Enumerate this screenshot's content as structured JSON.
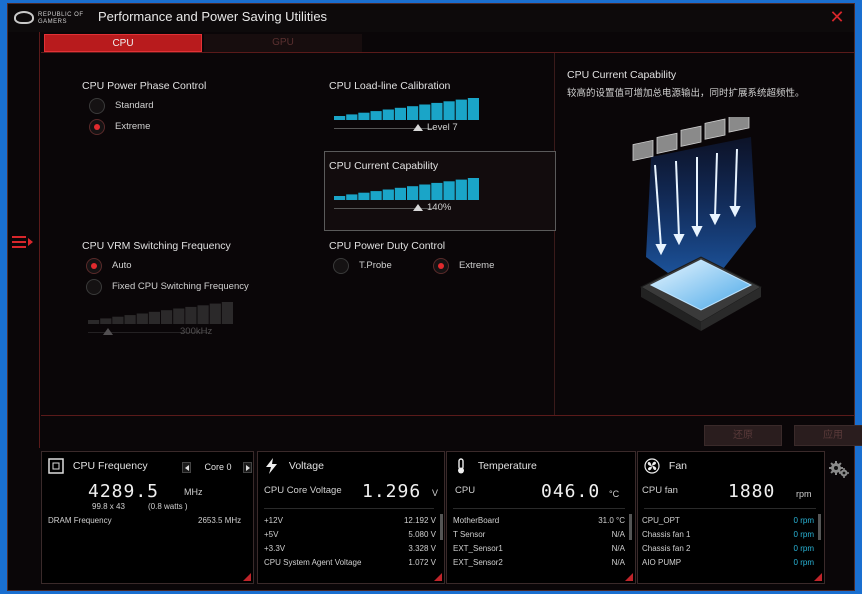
{
  "window": {
    "title": "Performance and Power Saving Utilities",
    "logo_line1": "REPUBLIC OF",
    "logo_line2": "GAMERS"
  },
  "tabs": [
    {
      "label": "CPU",
      "active": true
    },
    {
      "label": "GPU",
      "active": false
    }
  ],
  "sections": {
    "phase_control": {
      "title": "CPU Power Phase Control",
      "options": [
        {
          "label": "Standard",
          "selected": false
        },
        {
          "label": "Extreme",
          "selected": true
        }
      ]
    },
    "load_line": {
      "title": "CPU Load-line Calibration",
      "value": "Level 7",
      "level": 7,
      "max": 7
    },
    "current_capability": {
      "title": "CPU Current Capability",
      "value": "140%"
    },
    "vrm_frequency": {
      "title": "CPU VRM Switching Frequency",
      "options": [
        {
          "label": "Auto",
          "selected": true
        },
        {
          "label": "Fixed CPU Switching Frequency",
          "selected": false
        }
      ],
      "value": "300kHz"
    },
    "duty_control": {
      "title": "CPU Power Duty Control",
      "options": [
        {
          "label": "T.Probe",
          "selected": false
        },
        {
          "label": "Extreme",
          "selected": true
        }
      ]
    }
  },
  "info": {
    "title": "CPU Current Capability",
    "description": "较高的设置值可增加总电源输出，同时扩展系统超频性。"
  },
  "buttons": {
    "revert": "还原",
    "apply": "应用"
  },
  "monitors": {
    "frequency": {
      "title": "CPU Frequency",
      "core": "Core 0",
      "value": "4289.5",
      "unit": "MHz",
      "detail_mult": "99.8  x  43",
      "detail_watts": "(0.8   watts )",
      "dram_label": "DRAM Frequency",
      "dram_value": "2653.5  MHz"
    },
    "voltage": {
      "title": "Voltage",
      "main_label": "CPU Core Voltage",
      "main_value": "1.296",
      "main_unit": "V",
      "rows": [
        {
          "label": "+12V",
          "value": "12.192  V"
        },
        {
          "label": "+5V",
          "value": "5.080  V"
        },
        {
          "label": "+3.3V",
          "value": "3.328  V"
        },
        {
          "label": "CPU System Agent Voltage",
          "value": "1.072  V"
        }
      ]
    },
    "temperature": {
      "title": "Temperature",
      "main_label": "CPU",
      "main_value": "046.0",
      "main_unit": "°C",
      "rows": [
        {
          "label": "MotherBoard",
          "value": "31.0 °C"
        },
        {
          "label": "T Sensor",
          "value": "N/A"
        },
        {
          "label": "EXT_Sensor1",
          "value": "N/A"
        },
        {
          "label": "EXT_Sensor2",
          "value": "N/A"
        }
      ]
    },
    "fan": {
      "title": "Fan",
      "main_label": "CPU fan",
      "main_value": "1880",
      "main_unit": "rpm",
      "rows": [
        {
          "label": "CPU_OPT",
          "value": "0   rpm"
        },
        {
          "label": "Chassis fan 1",
          "value": "0   rpm"
        },
        {
          "label": "Chassis fan 2",
          "value": "0   rpm"
        },
        {
          "label": "AIO PUMP",
          "value": "0   rpm"
        }
      ]
    }
  },
  "colors": {
    "accent": "#e02a2e",
    "bar": "#1aa5c8",
    "tab_active": "#b81b1d"
  },
  "icons": [
    "rog-eye-icon",
    "close-icon",
    "menu-toggle-icon",
    "cpu-chip-icon",
    "lightning-icon",
    "thermometer-icon",
    "fan-icon",
    "gear-icon",
    "chevron-left-icon",
    "chevron-right-icon"
  ]
}
